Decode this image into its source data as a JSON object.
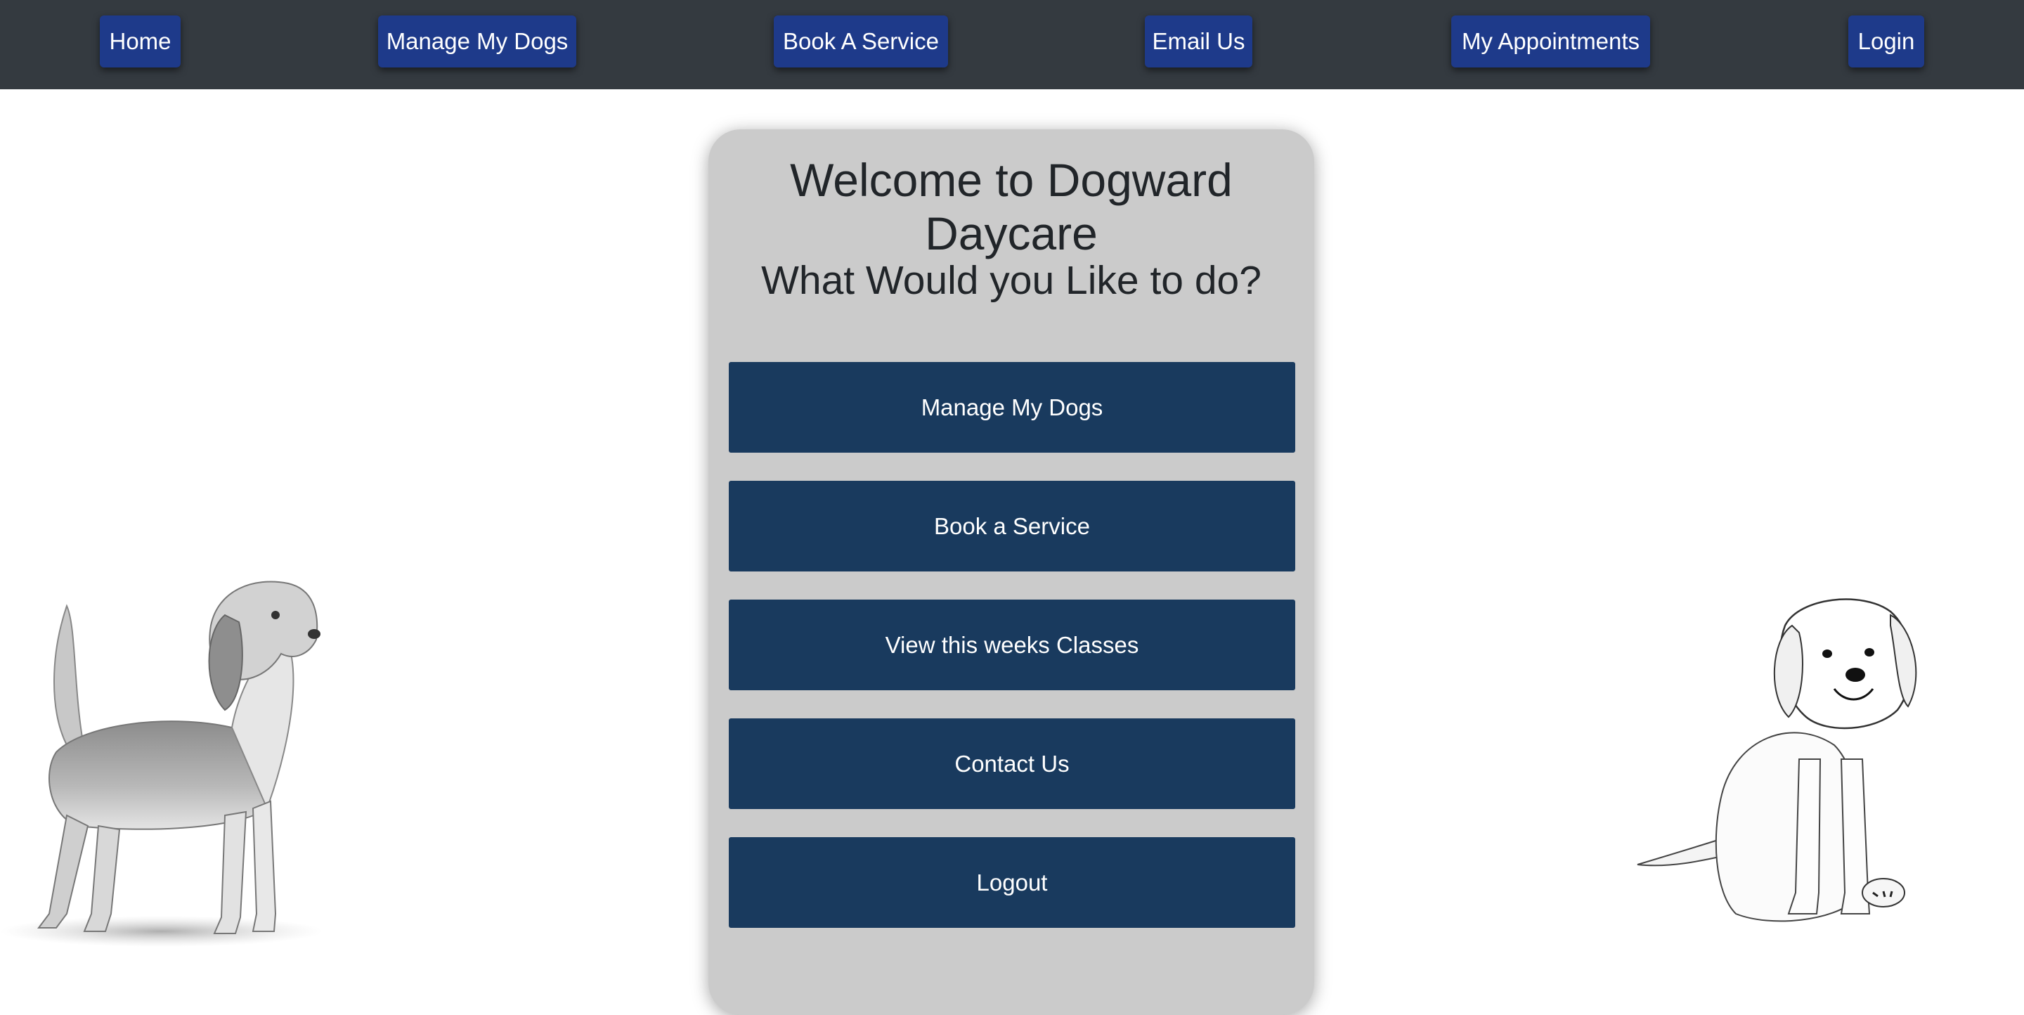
{
  "nav": {
    "home": "Home",
    "manage_dogs": "Manage My Dogs",
    "book_service": "Book A Service",
    "email_us": "Email Us",
    "my_appointments": "My Appointments",
    "login": "Login"
  },
  "main": {
    "title": "Welcome to Dogward Daycare",
    "subtitle": "What Would you Like to do?",
    "actions": {
      "manage_dogs": "Manage My Dogs",
      "book_service": "Book a Service",
      "view_classes": "View this weeks Classes",
      "contact_us": "Contact Us",
      "logout": "Logout"
    }
  },
  "colors": {
    "navbar_bg": "#343a40",
    "nav_button_bg": "#1e3a8a",
    "action_button_bg": "#193a5e",
    "card_bg": "#cbcbcb",
    "text_dark": "#212529"
  },
  "images": {
    "left": "beagle-sketch",
    "right": "puppy-sketch"
  }
}
